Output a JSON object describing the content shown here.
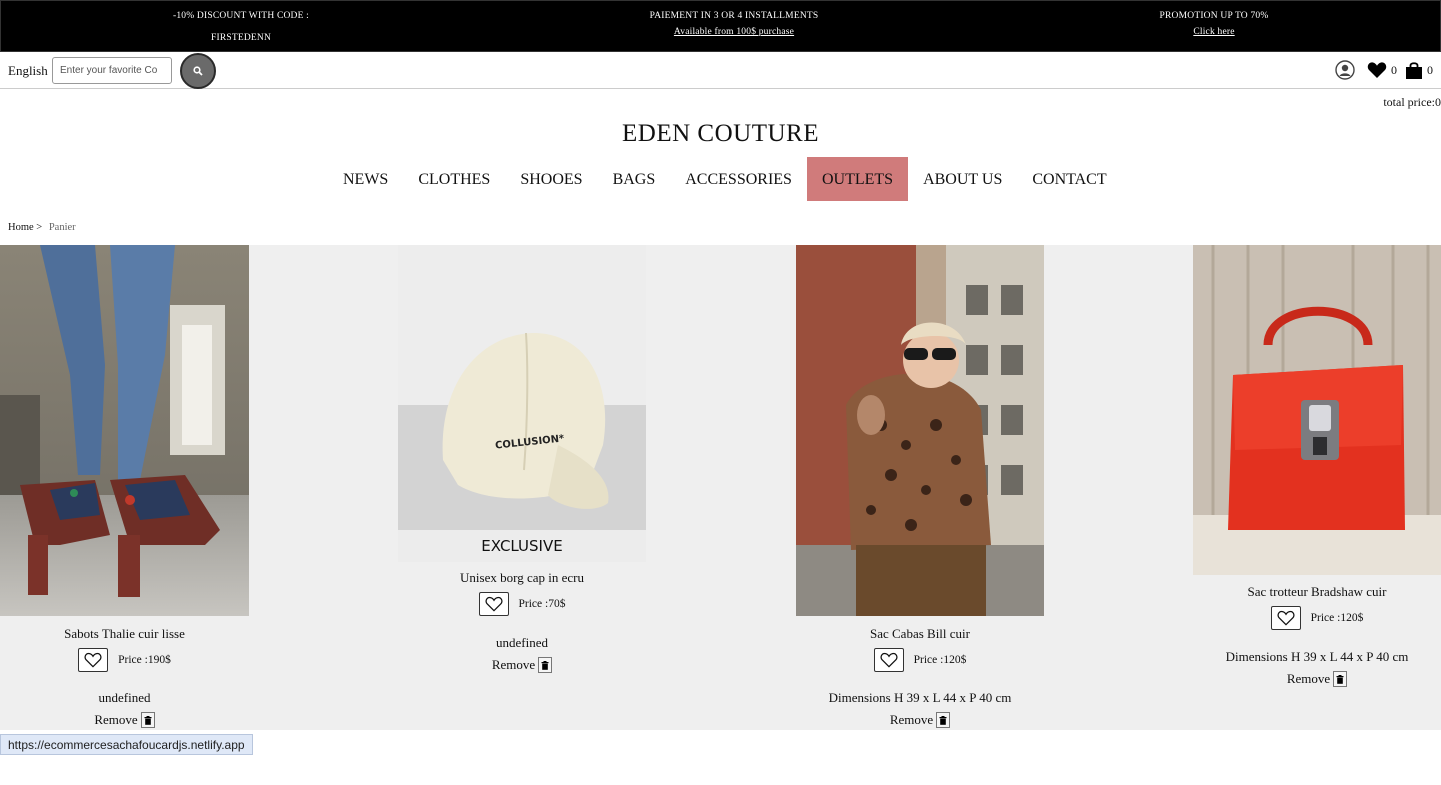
{
  "promos": [
    {
      "line1": "-10% DISCOUNT WITH CODE :",
      "line2": "FIRSTEDENN"
    },
    {
      "line1": "PAIEMENT IN 3 OR 4 INSTALLMENTS",
      "line2": "Available from 100$ purchase"
    },
    {
      "line1": "PROMOTION UP TO 70%",
      "line2": "Click here"
    }
  ],
  "toolbar": {
    "language": "English",
    "search_placeholder": "Enter your favorite Co",
    "wishlist_count": "0",
    "cart_count": "0"
  },
  "total_price": "total price:0",
  "brand": "EDEN COUTURE",
  "nav": {
    "items": [
      "NEWS",
      "CLOTHES",
      "SHOOES",
      "BAGS",
      "ACCESSORIES",
      "OUTLETS",
      "ABOUT US",
      "CONTACT"
    ],
    "active": "OUTLETS"
  },
  "breadcrumb": {
    "home": "Home >",
    "current": "Panier"
  },
  "products": [
    {
      "name": "Sabots Thalie cuir lisse",
      "price": "Price :190$",
      "extra": "undefined",
      "remove": "Remove"
    },
    {
      "name": "Unisex borg cap in ecru",
      "price": "Price :70$",
      "extra": "undefined",
      "remove": "Remove",
      "badge": "EXCLUSIVE",
      "cap_text": "COLLUSION*"
    },
    {
      "name": "Sac Cabas Bill cuir",
      "price": "Price :120$",
      "extra": "Dimensions H 39 x L 44 x P 40 cm",
      "remove": "Remove"
    },
    {
      "name": "Sac trotteur Bradshaw cuir",
      "price": "Price :120$",
      "extra": "Dimensions H 39 x L 44 x P 40 cm",
      "remove": "Remove"
    }
  ],
  "status_url": "https://ecommercesachafoucardjs.netlify.app",
  "colors": {
    "promo_bg": "#000000",
    "active_nav": "#d07b7b",
    "product_bg": "#efefef"
  }
}
